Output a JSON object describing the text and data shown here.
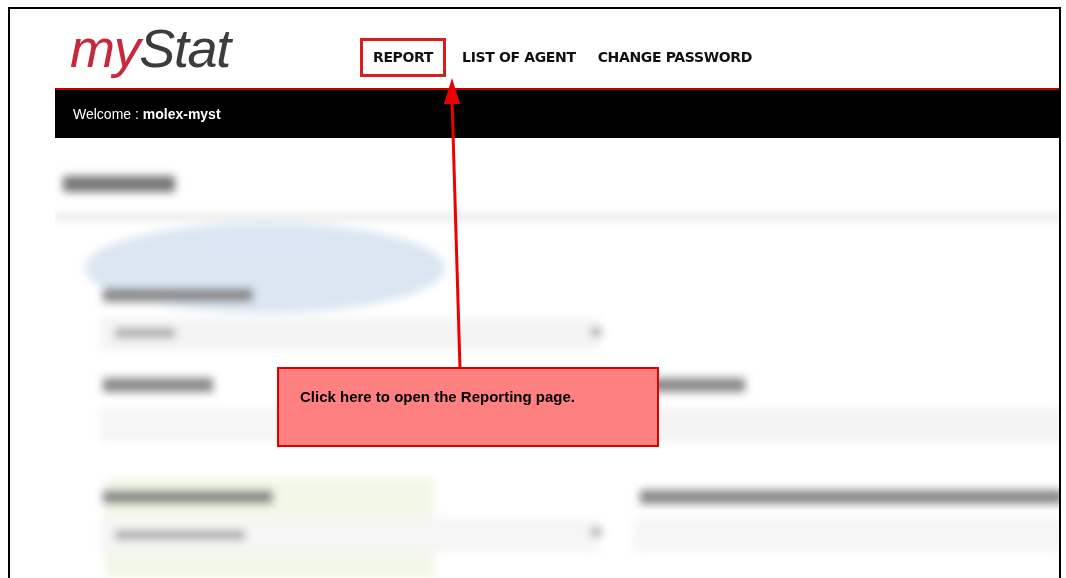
{
  "logo": {
    "first": "my",
    "second": "Stat"
  },
  "nav": [
    {
      "label": "REPORT",
      "highlighted": true
    },
    {
      "label": "LIST OF AGENT",
      "highlighted": false
    },
    {
      "label": "CHANGE PASSWORD",
      "highlighted": false
    }
  ],
  "welcome": "Welcome : **molex-myst**",
  "callout": {
    "text": "Click here to open the Reporting page."
  }
}
